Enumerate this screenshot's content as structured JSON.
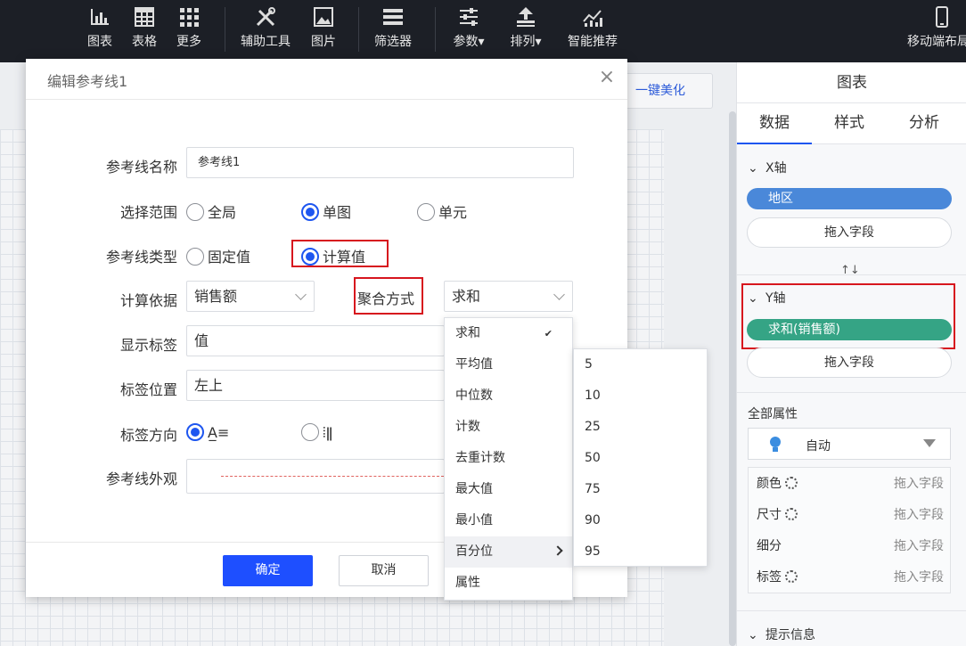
{
  "toolbar": {
    "items": [
      {
        "label": "图表",
        "icon": "bar-chart-icon"
      },
      {
        "label": "表格",
        "icon": "table-icon"
      },
      {
        "label": "更多",
        "icon": "grid-icon"
      },
      {
        "label": "辅助工具",
        "icon": "tools-icon"
      },
      {
        "label": "图片",
        "icon": "image-icon"
      },
      {
        "label": "筛选器",
        "icon": "filter-list-icon"
      },
      {
        "label": "参数",
        "icon": "sliders-icon"
      },
      {
        "label": "排列",
        "icon": "arrange-icon"
      },
      {
        "label": "智能推荐",
        "icon": "trend-chart-icon"
      },
      {
        "label": "移动端布局",
        "icon": "mobile-icon"
      }
    ]
  },
  "canvas": {
    "beautify_label": "一键美化"
  },
  "right_panel": {
    "title": "图表",
    "tabs": [
      "数据",
      "样式",
      "分析"
    ],
    "x_axis": {
      "label": "X轴",
      "field": "地区",
      "drop_label": "拖入字段"
    },
    "swap_icon": "↑↓",
    "y_axis": {
      "label": "Y轴",
      "field": "求和(销售额)",
      "drop_label": "拖入字段"
    },
    "all_props": {
      "label": "全部属性",
      "mark_type": "自动",
      "rows": [
        {
          "label": "颜色",
          "drop": "拖入字段"
        },
        {
          "label": "尺寸",
          "drop": "拖入字段"
        },
        {
          "label": "细分",
          "drop": "拖入字段"
        },
        {
          "label": "标签",
          "drop": "拖入字段"
        }
      ]
    },
    "tooltip_section": "提示信息",
    "colors": {
      "x_pill": "#4a88d9",
      "y_pill": "#35a485",
      "accent": "#1e56f0",
      "highlight": "#d7161e"
    }
  },
  "modal": {
    "title": "编辑参考线1",
    "close_icon": "×",
    "name_label": "参考线名称",
    "name_value": "参考线1",
    "range_label": "选择范围",
    "range_options": [
      "全局",
      "单图",
      "单元"
    ],
    "range_selected": "单图",
    "type_label": "参考线类型",
    "type_options": [
      "固定值",
      "计算值"
    ],
    "type_selected": "计算值",
    "basis_label": "计算依据",
    "basis_value": "销售额",
    "agg_label": "聚合方式",
    "agg_value": "求和",
    "show_label_label": "显示标签",
    "show_label_value": "值",
    "label_pos_label": "标签位置",
    "label_pos_value": "左上",
    "label_dir_label": "标签方向",
    "label_dir_options": [
      "A̲≡",
      "⦙ǁ"
    ],
    "appearance_label": "参考线外观",
    "confirm_label": "确定",
    "cancel_label": "取消"
  },
  "agg_menu": {
    "items": [
      "求和",
      "平均值",
      "中位数",
      "计数",
      "去重计数",
      "最大值",
      "最小值",
      "百分位",
      "属性"
    ],
    "checked": "求和",
    "check_mark": "✔",
    "highlighted": "百分位"
  },
  "percentile_menu": {
    "items": [
      "5",
      "10",
      "25",
      "50",
      "75",
      "90",
      "95"
    ]
  }
}
